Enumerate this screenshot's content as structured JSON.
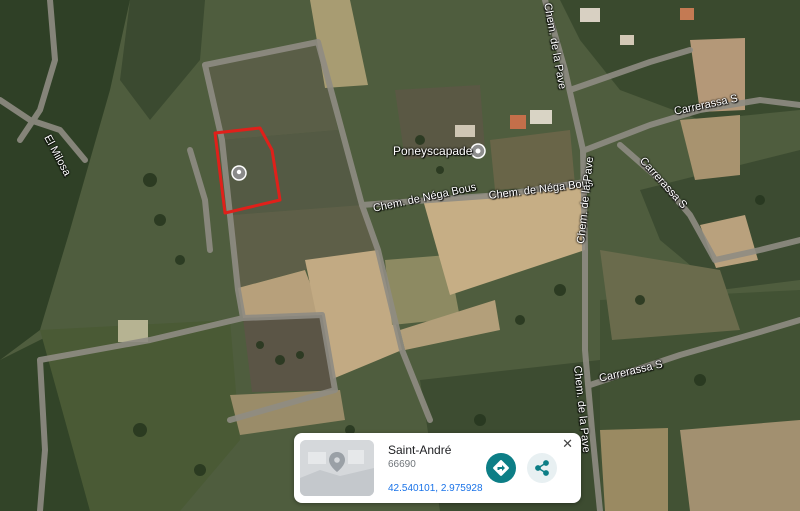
{
  "map": {
    "place_labels": {
      "poney": "Poneyscapade",
      "el_milosa": "El Milosa",
      "nega_bous_1": "Chem. de Néga Bous",
      "nega_bous_2": "Chem. de Néga Bous",
      "pave_1": "Chem. de la Pave",
      "pave_2": "Chem. de la Pave",
      "carrerassa_1": "Carrerassa S",
      "carrerassa_2": "Carrerassa S",
      "carrerassa_3": "Carrerassa S"
    },
    "parcel_outline_color": "#e0201a"
  },
  "card": {
    "title": "Saint-André",
    "postal_code": "66690",
    "coordinates": "42.540101, 2.975928",
    "close_glyph": "✕"
  },
  "icons": {
    "pin": "location-pin-icon",
    "poi": "place-marker-icon",
    "directions": "directions-icon",
    "share": "share-icon",
    "close": "close-icon"
  }
}
